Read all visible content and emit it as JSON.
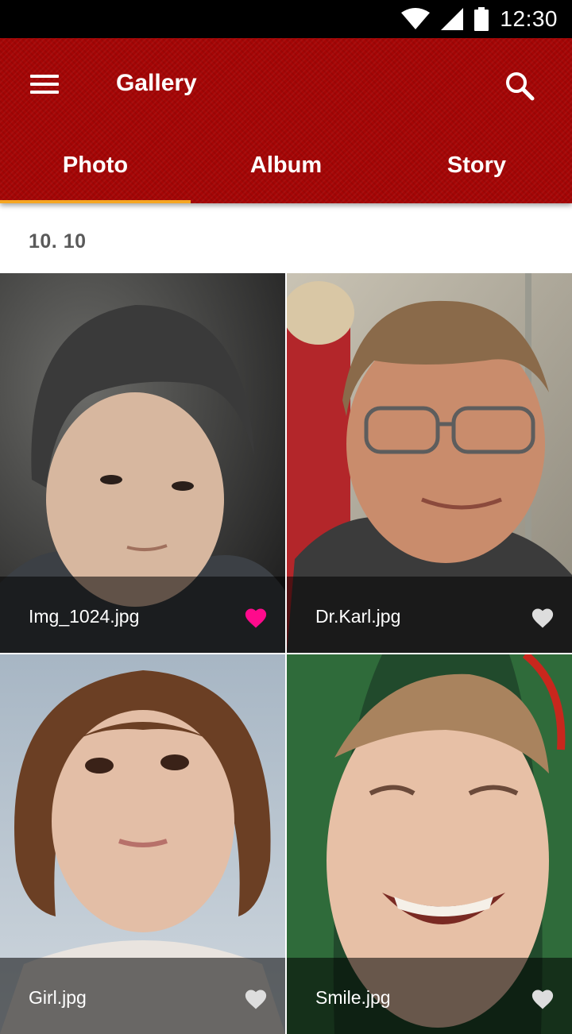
{
  "status_bar": {
    "time": "12:30",
    "icons": [
      "wifi-icon",
      "cell-signal-icon",
      "battery-icon"
    ]
  },
  "app_bar": {
    "title": "Gallery",
    "menu_icon": "hamburger-menu-icon",
    "search_icon": "search-icon",
    "color": "#a50505"
  },
  "tabs": [
    {
      "label": "Photo",
      "active": true
    },
    {
      "label": "Album",
      "active": false
    },
    {
      "label": "Story",
      "active": false
    }
  ],
  "tab_indicator_color": "#f5a623",
  "date_header": "10. 10",
  "photos": [
    {
      "name": "Img_1024.jpg",
      "favorite": true,
      "heart_color": "#ff0a8c"
    },
    {
      "name": "Dr.Karl.jpg",
      "favorite": false,
      "heart_color": "#dddddd"
    },
    {
      "name": "Girl.jpg",
      "favorite": false,
      "heart_color": "#dddddd"
    },
    {
      "name": "Smile.jpg",
      "favorite": false,
      "heart_color": "#dddddd"
    }
  ]
}
